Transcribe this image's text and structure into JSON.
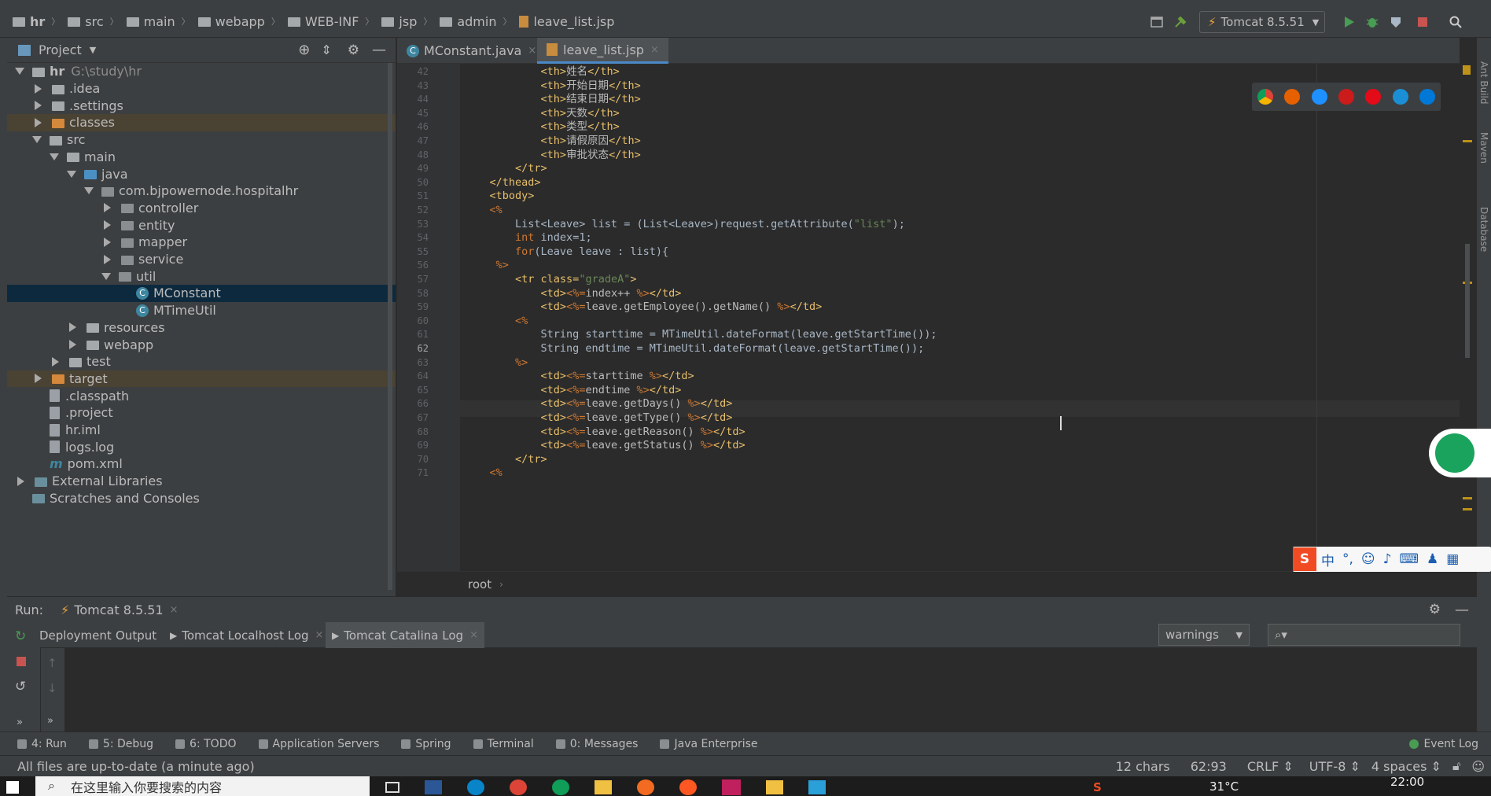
{
  "navbar": {
    "breadcrumbs": [
      "hr",
      "src",
      "main",
      "webapp",
      "WEB-INF",
      "jsp",
      "admin",
      "leave_list.jsp"
    ],
    "run_config": "Tomcat 8.5.51"
  },
  "project": {
    "title": "Project",
    "tree": [
      {
        "label": "hr",
        "extra": "G:\\study\\hr",
        "depth": 0,
        "kind": "folder",
        "state": "open"
      },
      {
        "label": ".idea",
        "depth": 1,
        "kind": "folder",
        "state": "closed"
      },
      {
        "label": ".settings",
        "depth": 1,
        "kind": "folder",
        "state": "closed"
      },
      {
        "label": "classes",
        "depth": 1,
        "kind": "folder-orange",
        "state": "closed",
        "highlight": true
      },
      {
        "label": "src",
        "depth": 1,
        "kind": "folder",
        "state": "open"
      },
      {
        "label": "main",
        "depth": 2,
        "kind": "folder",
        "state": "open"
      },
      {
        "label": "java",
        "depth": 3,
        "kind": "folder-blue",
        "state": "open"
      },
      {
        "label": "com.bjpowernode.hospitalhr",
        "depth": 4,
        "kind": "package",
        "state": "open"
      },
      {
        "label": "controller",
        "depth": 5,
        "kind": "package",
        "state": "closed"
      },
      {
        "label": "entity",
        "depth": 5,
        "kind": "package",
        "state": "closed"
      },
      {
        "label": "mapper",
        "depth": 5,
        "kind": "package",
        "state": "closed"
      },
      {
        "label": "service",
        "depth": 5,
        "kind": "package",
        "state": "closed"
      },
      {
        "label": "util",
        "depth": 5,
        "kind": "package",
        "state": "open"
      },
      {
        "label": "MConstant",
        "depth": 6,
        "kind": "class",
        "state": "leaf",
        "selected": true
      },
      {
        "label": "MTimeUtil",
        "depth": 6,
        "kind": "class",
        "state": "leaf"
      },
      {
        "label": "resources",
        "depth": 3,
        "kind": "folder",
        "state": "closed"
      },
      {
        "label": "webapp",
        "depth": 3,
        "kind": "folder",
        "state": "closed"
      },
      {
        "label": "test",
        "depth": 2,
        "kind": "folder",
        "state": "closed"
      },
      {
        "label": "target",
        "depth": 1,
        "kind": "folder-orange",
        "state": "closed",
        "highlight": true
      },
      {
        "label": ".classpath",
        "depth": 1,
        "kind": "file",
        "state": "leaf"
      },
      {
        "label": ".project",
        "depth": 1,
        "kind": "file",
        "state": "leaf"
      },
      {
        "label": "hr.iml",
        "depth": 1,
        "kind": "file",
        "state": "leaf"
      },
      {
        "label": "logs.log",
        "depth": 1,
        "kind": "file",
        "state": "leaf"
      },
      {
        "label": "pom.xml",
        "depth": 1,
        "kind": "maven",
        "state": "leaf"
      },
      {
        "label": "External Libraries",
        "depth": 0,
        "kind": "lib",
        "state": "closed"
      },
      {
        "label": "Scratches and Consoles",
        "depth": 0,
        "kind": "lib",
        "state": "leaf"
      }
    ]
  },
  "editor": {
    "tabs": [
      "MConstant.java",
      "leave_list.jsp"
    ],
    "active_tab": "leave_list.jsp",
    "breadcrumb": "root",
    "lines": [
      {
        "n": "42",
        "text": "            <th>姓名</th>"
      },
      {
        "n": "43",
        "text": "            <th>开始日期</th>"
      },
      {
        "n": "44",
        "text": "            <th>结束日期</th>"
      },
      {
        "n": "45",
        "text": "            <th>天数</th>"
      },
      {
        "n": "46",
        "text": "            <th>类型</th>"
      },
      {
        "n": "47",
        "text": "            <th>请假原因</th>"
      },
      {
        "n": "48",
        "text": "            <th>审批状态</th>"
      },
      {
        "n": "49",
        "text": "        </tr>"
      },
      {
        "n": "50",
        "text": "    </thead>"
      },
      {
        "n": "51",
        "text": "    <tbody>"
      },
      {
        "n": "52",
        "text": "    <%"
      },
      {
        "n": "53",
        "text": "        List<Leave> list = (List<Leave>)request.getAttribute(\"list\");"
      },
      {
        "n": "54",
        "text": "        int index=1;"
      },
      {
        "n": "55",
        "text": "        for(Leave leave : list){"
      },
      {
        "n": "56",
        "text": "     %>"
      },
      {
        "n": "57",
        "text": "        <tr class=\"gradeA\">"
      },
      {
        "n": "58",
        "text": "            <td><%=index++ %></td>"
      },
      {
        "n": "59",
        "text": "            <td><%=leave.getEmployee().getName() %></td>"
      },
      {
        "n": "60",
        "text": "        <%"
      },
      {
        "n": "61",
        "text": "            String starttime = MTimeUtil.dateFormat(leave.getStartTime());"
      },
      {
        "n": "62",
        "text": "            String endtime = MTimeUtil.dateFormat(leave.getStartTime());"
      },
      {
        "n": "63",
        "text": "        %>"
      },
      {
        "n": "64",
        "text": "            <td><%=starttime %></td>"
      },
      {
        "n": "65",
        "text": "            <td><%=endtime %></td>"
      },
      {
        "n": "66",
        "text": "            <td><%=leave.getDays() %></td>"
      },
      {
        "n": "67",
        "text": "            <td><%=leave.getType() %></td>"
      },
      {
        "n": "68",
        "text": "            <td><%=leave.getReason() %></td>"
      },
      {
        "n": "69",
        "text": "            <td><%=leave.getStatus() %></td>"
      },
      {
        "n": "70",
        "text": "        </tr>"
      },
      {
        "n": "71",
        "text": "    <%"
      }
    ]
  },
  "run": {
    "label": "Run:",
    "config": "Tomcat 8.5.51",
    "tabs": [
      "Deployment",
      "Output",
      "Tomcat Localhost Log",
      "Tomcat Catalina Log"
    ],
    "filter_value": "warnings",
    "search_placeholder": ""
  },
  "toolwindows": [
    "4: Run",
    "5: Debug",
    "6: TODO",
    "Application Servers",
    "Spring",
    "Terminal",
    "0: Messages",
    "Java Enterprise"
  ],
  "event_log": "Event Log",
  "status": {
    "message": "All files are up-to-date (a minute ago)",
    "chars": "12 chars",
    "position": "62:93",
    "line_sep": "CRLF",
    "encoding": "UTF-8",
    "indent": "4 spaces"
  },
  "taskbar": {
    "search_text": "在这里输入你要搜索的内容",
    "temperature": "31°C",
    "clock": "22:00"
  },
  "ime": {
    "text": "中"
  },
  "colors": {
    "accent": "#4a88c7",
    "selection": "#0d293e",
    "excluded": "#4a4233"
  }
}
